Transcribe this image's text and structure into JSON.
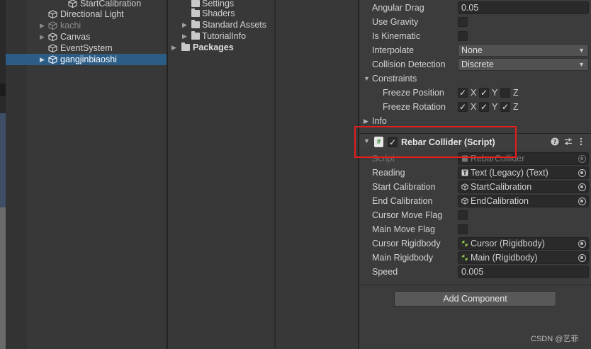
{
  "hierarchy": {
    "items": [
      {
        "label": "StartCalibration"
      },
      {
        "label": "Directional Light"
      },
      {
        "label": "kachi"
      },
      {
        "label": "Canvas"
      },
      {
        "label": "EventSystem"
      },
      {
        "label": "gangjinbiaoshi"
      }
    ]
  },
  "project": {
    "items": [
      {
        "label": "Settings"
      },
      {
        "label": "Shaders"
      },
      {
        "label": "Standard Assets"
      },
      {
        "label": "TutorialInfo"
      },
      {
        "label": "Packages"
      }
    ]
  },
  "inspector": {
    "rigidbody": {
      "angular_drag_label": "Angular Drag",
      "angular_drag_value": "0.05",
      "use_gravity_label": "Use Gravity",
      "is_kinematic_label": "Is Kinematic",
      "interpolate_label": "Interpolate",
      "interpolate_value": "None",
      "collision_label": "Collision Detection",
      "collision_value": "Discrete",
      "constraints_label": "Constraints",
      "freeze_position_label": "Freeze Position",
      "freeze_rotation_label": "Freeze Rotation",
      "axis_x": "X",
      "axis_y": "Y",
      "axis_z": "Z",
      "info_label": "Info"
    },
    "component": {
      "title": "Rebar Collider (Script)",
      "script_icon": "#",
      "fields": {
        "script_label": "Script",
        "script_value": "RebarCollider",
        "reading_label": "Reading",
        "reading_value": "Text (Legacy) (Text)",
        "start_cal_label": "Start Calibration",
        "start_cal_value": "StartCalibration",
        "end_cal_label": "End Calibration",
        "end_cal_value": "EndCalibration",
        "cursor_move_label": "Cursor Move Flag",
        "main_move_label": "Main Move Flag",
        "cursor_rb_label": "Cursor Rigidbody",
        "cursor_rb_value": "Cursor (Rigidbody)",
        "main_rb_label": "Main Rigidbody",
        "main_rb_value": "Main (Rigidbody)",
        "speed_label": "Speed",
        "speed_value": "0.005"
      }
    },
    "add_component_label": "Add Component"
  },
  "watermark": "CSDN @艺菲",
  "colors": {
    "selection": "#2c5d87",
    "highlight": "#e21e1e",
    "panel": "#383838"
  }
}
